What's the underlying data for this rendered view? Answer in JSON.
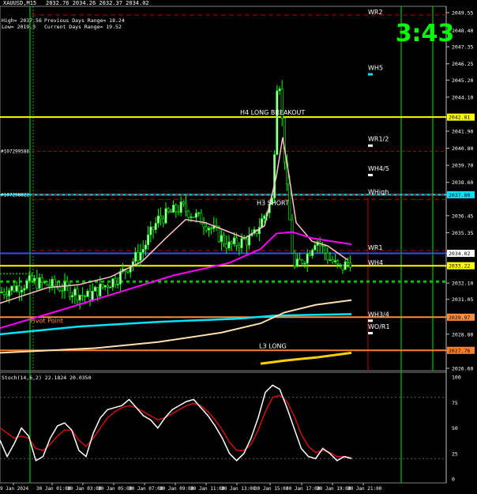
{
  "window": {
    "symbol_title": "XAUUSD,M15",
    "ohlc_line": "2032.76 2034.26 2032.37 2034.02",
    "high_line": "High= 2037.56",
    "prev_range": "Previous Days Range= 18.24",
    "low_line": "Low= 2019.3",
    "current_range": "Current Days Range= 19.52",
    "timer": "3:43"
  },
  "price_axis": {
    "ticks": [
      "2049.55",
      "2048.40",
      "2047.35",
      "2046.25",
      "2045.20",
      "2044.10",
      "2042.81",
      "2041.90",
      "2040.80",
      "2039.70",
      "2038.60",
      "2037.80",
      "2036.45",
      "2035.35",
      "2034.02",
      "2033.22",
      "2032.10",
      "2031.05",
      "2029.97",
      "2028.80",
      "2027.76",
      "2026.60"
    ],
    "tick_prices": [
      2049.55,
      2048.4,
      2047.35,
      2046.25,
      2045.2,
      2044.1,
      2042.81,
      2041.9,
      2040.8,
      2039.7,
      2038.6,
      2037.8,
      2036.45,
      2035.35,
      2034.02,
      2033.22,
      2032.1,
      2031.05,
      2029.97,
      2028.8,
      2027.76,
      2026.6
    ],
    "range": [
      2026.6,
      2049.55
    ]
  },
  "time_axis": {
    "labels": [
      "9 Jan 2024",
      "30 Jan 01:00",
      "30 Jan 03:00",
      "30 Jan 05:00",
      "30 Jan 07:00",
      "30 Jan 09:00",
      "30 Jan 11:00",
      "30 Jan 13:00",
      "30 Jan 15:00",
      "30 Jan 17:00",
      "30 Jan 19:00",
      "30 Jan 21:00"
    ]
  },
  "levels": [
    {
      "label": "WR2",
      "price": 2049.4,
      "color": "#c00000",
      "style": "dash"
    },
    {
      "label": "WH5",
      "price": 2045.8,
      "color": "#00e5ff",
      "style": "marker"
    },
    {
      "label": "H4 LONG BREAKOUT",
      "price": 2042.81,
      "color": "#ffff00",
      "style": "solid",
      "badge": "2042.81"
    },
    {
      "label": "WR1/2",
      "price": 2041.2,
      "color": "#ffffff",
      "style": "marker"
    },
    {
      "label": "WH4/5",
      "price": 2039.3,
      "color": "#ffffff",
      "style": "marker"
    },
    {
      "label": "WHigh",
      "price": 2037.8,
      "color": "#00e5ff",
      "style": "solid",
      "badge": "2037.80"
    },
    {
      "label": "H3 SHORT",
      "price": 2037.5,
      "color": "#c00000",
      "style": "dash"
    },
    {
      "label": "WR1",
      "price": 2034.2,
      "color": "#c00000",
      "style": "dash"
    },
    {
      "label": "WH4",
      "price": 2033.22,
      "color": "#ffff00",
      "style": "solid",
      "badge": "2033.22"
    },
    {
      "label": "Pivot Point",
      "price": 2029.9,
      "color": "#ff8c3c",
      "style": "solid",
      "badge": "2029.97"
    },
    {
      "label": "WH3/4",
      "price": 2029.9,
      "color": "#ffffff",
      "style": "marker"
    },
    {
      "label": "WO/R1",
      "price": 2029.1,
      "color": "#ffffff",
      "style": "marker"
    },
    {
      "label": "L3 LONG",
      "price": 2027.76,
      "color": "#ff7f27",
      "style": "solid",
      "badge": "2027.76"
    }
  ],
  "orders": [
    {
      "label": "#107299586",
      "price": 2040.6
    },
    {
      "label": "#107298822",
      "price": 2037.8
    }
  ],
  "price_badge": {
    "text": "2034.02",
    "price": 2034.02
  },
  "stoch": {
    "title": "Stoch(14,6,2) 22.1824 20.0350",
    "ticks": [
      "100",
      "75",
      "50",
      "25",
      "0"
    ],
    "tick_values": [
      100,
      75,
      50,
      25,
      0
    ],
    "main": [
      38,
      22,
      35,
      50,
      42,
      18,
      22,
      40,
      52,
      55,
      48,
      28,
      22,
      45,
      60,
      68,
      70,
      72,
      78,
      70,
      62,
      58,
      50,
      60,
      68,
      72,
      76,
      78,
      70,
      62,
      52,
      40,
      25,
      18,
      25,
      40,
      60,
      85,
      92,
      88,
      70,
      50,
      30,
      22,
      20,
      30,
      25,
      18,
      22,
      20
    ],
    "signal": [
      50,
      45,
      40,
      42,
      40,
      30,
      28,
      34,
      42,
      48,
      48,
      38,
      32,
      40,
      50,
      60,
      66,
      70,
      72,
      70,
      66,
      62,
      58,
      60,
      64,
      68,
      72,
      74,
      72,
      66,
      58,
      48,
      36,
      28,
      28,
      34,
      48,
      66,
      80,
      82,
      76,
      62,
      44,
      32,
      26,
      28,
      26,
      22,
      22,
      21
    ]
  },
  "colors": {
    "bg": "#000000",
    "axis": "#ffffff",
    "candle": "#00ff00",
    "candle_bull_fill": "#c8ffc8",
    "ma_pink": "#ffc0cb",
    "ma_magenta": "#ff00ff",
    "ma_cyan": "#00e5ff",
    "ma_peach": "#ffe0b0",
    "ma_gold": "#ffd000",
    "session_line": "#00c000",
    "timer": "#00ff00"
  }
}
